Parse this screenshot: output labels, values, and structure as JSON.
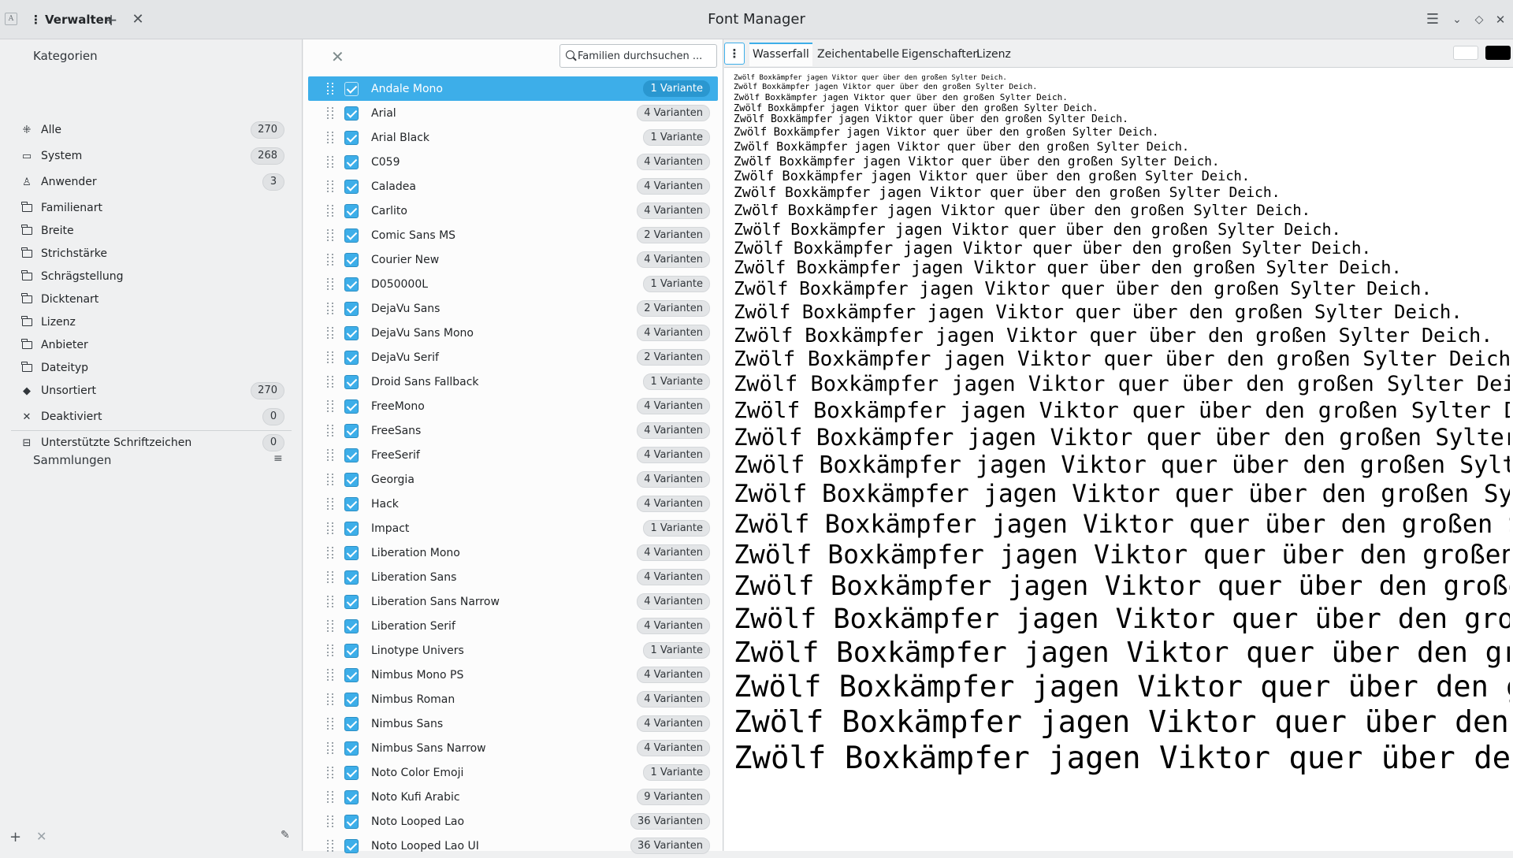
{
  "window": {
    "title": "Font Manager",
    "manage_label": "Verwalten",
    "app_icon_glyph": "A"
  },
  "sidebar": {
    "categories_heading": "Kategorien",
    "categories": [
      {
        "label": "Alle",
        "icon": "grid-icon",
        "count": "270"
      },
      {
        "label": "System",
        "icon": "monitor-icon",
        "count": "268"
      },
      {
        "label": "Anwender",
        "icon": "user-icon",
        "count": "3"
      },
      {
        "label": "Familienart",
        "icon": "folder-icon"
      },
      {
        "label": "Breite",
        "icon": "folder-icon"
      },
      {
        "label": "Strichstärke",
        "icon": "folder-icon"
      },
      {
        "label": "Schrägstellung",
        "icon": "folder-icon"
      },
      {
        "label": "Dicktenart",
        "icon": "folder-icon"
      },
      {
        "label": "Lizenz",
        "icon": "folder-icon"
      },
      {
        "label": "Anbieter",
        "icon": "folder-icon"
      },
      {
        "label": "Dateityp",
        "icon": "folder-icon"
      },
      {
        "label": "Unsortiert",
        "icon": "unknown-icon",
        "count": "270"
      },
      {
        "label": "Deaktiviert",
        "icon": "disabled-icon",
        "count": "0"
      },
      {
        "label": "Unterstützte Schriftzeichen",
        "icon": "charset-icon",
        "count": "0"
      }
    ],
    "collections_heading": "Sammlungen"
  },
  "font_list": {
    "search_placeholder": "Familien durchsuchen ...",
    "families": [
      {
        "name": "Andale Mono",
        "variants": "1 Variante",
        "selected": true
      },
      {
        "name": "Arial",
        "variants": "4 Varianten"
      },
      {
        "name": "Arial Black",
        "variants": "1 Variante"
      },
      {
        "name": "C059",
        "variants": "4 Varianten"
      },
      {
        "name": "Caladea",
        "variants": "4 Varianten"
      },
      {
        "name": "Carlito",
        "variants": "4 Varianten"
      },
      {
        "name": "Comic Sans MS",
        "variants": "2 Varianten"
      },
      {
        "name": "Courier New",
        "variants": "4 Varianten"
      },
      {
        "name": "D050000L",
        "variants": "1 Variante"
      },
      {
        "name": "DejaVu Sans",
        "variants": "2 Varianten"
      },
      {
        "name": "DejaVu Sans Mono",
        "variants": "4 Varianten"
      },
      {
        "name": "DejaVu Serif",
        "variants": "2 Varianten"
      },
      {
        "name": "Droid Sans Fallback",
        "variants": "1 Variante"
      },
      {
        "name": "FreeMono",
        "variants": "4 Varianten"
      },
      {
        "name": "FreeSans",
        "variants": "4 Varianten"
      },
      {
        "name": "FreeSerif",
        "variants": "4 Varianten"
      },
      {
        "name": "Georgia",
        "variants": "4 Varianten"
      },
      {
        "name": "Hack",
        "variants": "4 Varianten"
      },
      {
        "name": "Impact",
        "variants": "1 Variante"
      },
      {
        "name": "Liberation Mono",
        "variants": "4 Varianten"
      },
      {
        "name": "Liberation Sans",
        "variants": "4 Varianten"
      },
      {
        "name": "Liberation Sans Narrow",
        "variants": "4 Varianten"
      },
      {
        "name": "Liberation Serif",
        "variants": "4 Varianten"
      },
      {
        "name": "Linotype Univers",
        "variants": "1 Variante"
      },
      {
        "name": "Nimbus Mono PS",
        "variants": "4 Varianten"
      },
      {
        "name": "Nimbus Roman",
        "variants": "4 Varianten"
      },
      {
        "name": "Nimbus Sans",
        "variants": "4 Varianten"
      },
      {
        "name": "Nimbus Sans Narrow",
        "variants": "4 Varianten"
      },
      {
        "name": "Noto Color Emoji",
        "variants": "1 Variante"
      },
      {
        "name": "Noto Kufi Arabic",
        "variants": "9 Varianten"
      },
      {
        "name": "Noto Looped Lao",
        "variants": "36 Varianten"
      },
      {
        "name": "Noto Looped Lao UI",
        "variants": "36 Varianten"
      }
    ]
  },
  "preview": {
    "tabs": [
      "Wasserfall",
      "Zeichentabelle",
      "Eigenschaften",
      "Lizenz"
    ],
    "active_tab": "Wasserfall",
    "sample_text": "Zwölf Boxkämpfer jagen Viktor quer über den großen Sylter Deich.",
    "line_count": 31,
    "background_swatch": "#ffffff",
    "foreground_swatch": "#000000"
  },
  "colors": {
    "accent": "#3daee9",
    "window_bg": "#eff0f1"
  }
}
